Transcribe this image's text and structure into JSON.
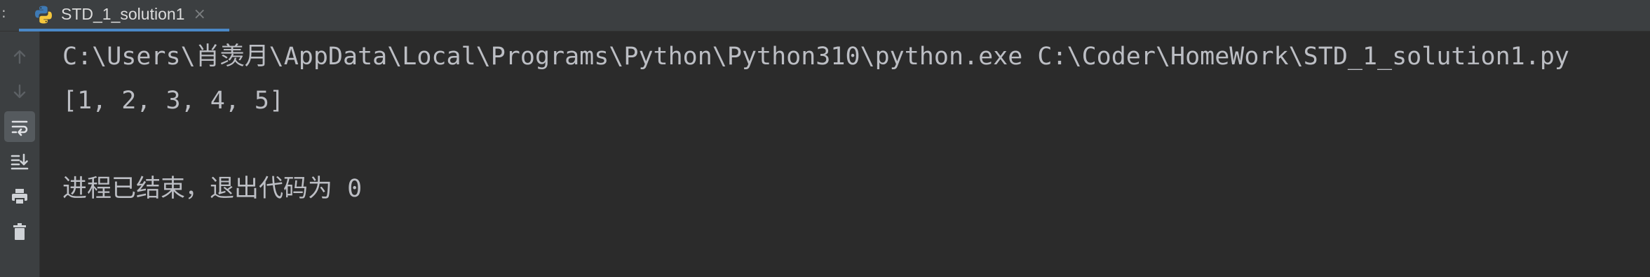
{
  "tabbar": {
    "edge_glyph": ":",
    "tab": {
      "title": "STD_1_solution1",
      "close_glyph": "×",
      "icon": "python-icon"
    }
  },
  "gutter": {
    "buttons": [
      {
        "icon": "arrow-up-icon",
        "state": "disabled"
      },
      {
        "icon": "arrow-down-icon",
        "state": "disabled"
      },
      {
        "icon": "soft-wrap-icon",
        "state": "active"
      },
      {
        "icon": "scroll-to-end-icon",
        "state": "normal"
      },
      {
        "icon": "print-icon",
        "state": "normal"
      },
      {
        "icon": "trash-icon",
        "state": "normal"
      }
    ]
  },
  "console": {
    "lines": [
      "C:\\Users\\肖羡月\\AppData\\Local\\Programs\\Python\\Python310\\python.exe C:\\Coder\\HomeWork\\STD_1_solution1.py",
      "[1, 2, 3, 4, 5]",
      "",
      "进程已结束，退出代码为 0"
    ]
  },
  "colors": {
    "background": "#2b2b2b",
    "panel": "#3c3f41",
    "text": "#bcbec4",
    "tab_underline": "#4a88c7",
    "python_blue": "#3e7ab5",
    "python_yellow": "#f5c73d",
    "icon_active": "#dfe1e5",
    "icon_disabled": "#5c6064"
  }
}
